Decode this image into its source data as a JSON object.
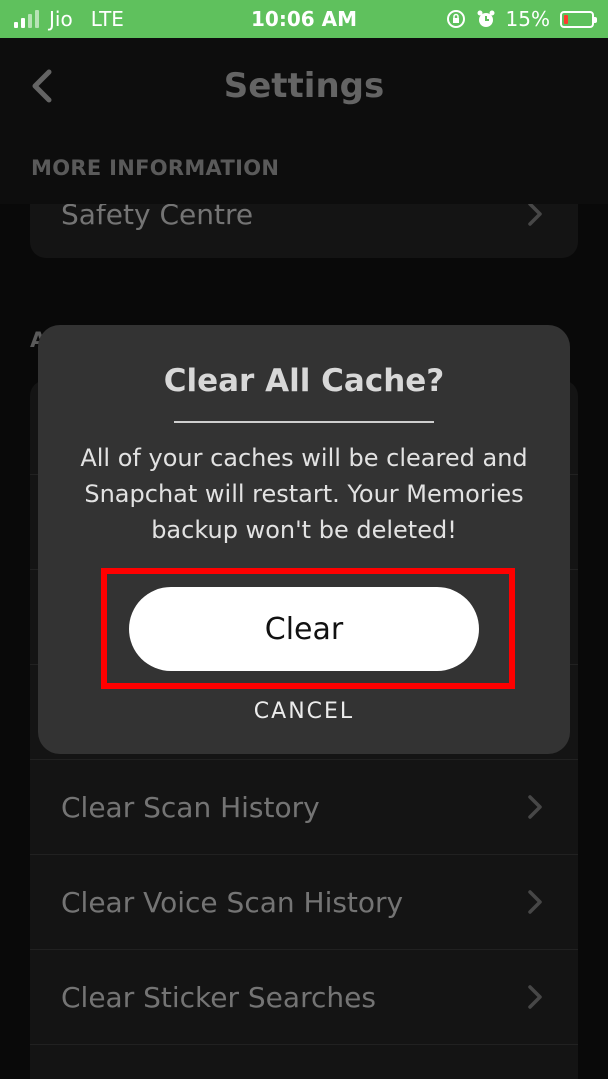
{
  "status_bar": {
    "carrier": "Jio",
    "network": "LTE",
    "time": "10:06 AM",
    "battery_percent": "15%",
    "battery_level": 0.15,
    "icons": [
      "signal-icon",
      "lock-rotation-icon",
      "alarm-icon",
      "battery-icon"
    ],
    "bg_color": "#5fc15d"
  },
  "header": {
    "back_icon": "chevron-left-icon",
    "title": "Settings",
    "section_label": "MORE INFORMATION"
  },
  "list_top": {
    "items": [
      {
        "label": "Safety Centre"
      }
    ]
  },
  "list_section_partial_label": "A",
  "list_bottom": {
    "items": [
      {
        "label": "Clear Scan History"
      },
      {
        "label": "Clear Voice Scan History"
      },
      {
        "label": "Clear Sticker Searches"
      }
    ]
  },
  "dialog": {
    "title": "Clear All Cache?",
    "message": "All of your caches will be cleared and Snapchat will restart. Your Memories backup won't be deleted!",
    "confirm_label": "Clear",
    "cancel_label": "CANCEL",
    "highlight_color": "#ff0000"
  }
}
